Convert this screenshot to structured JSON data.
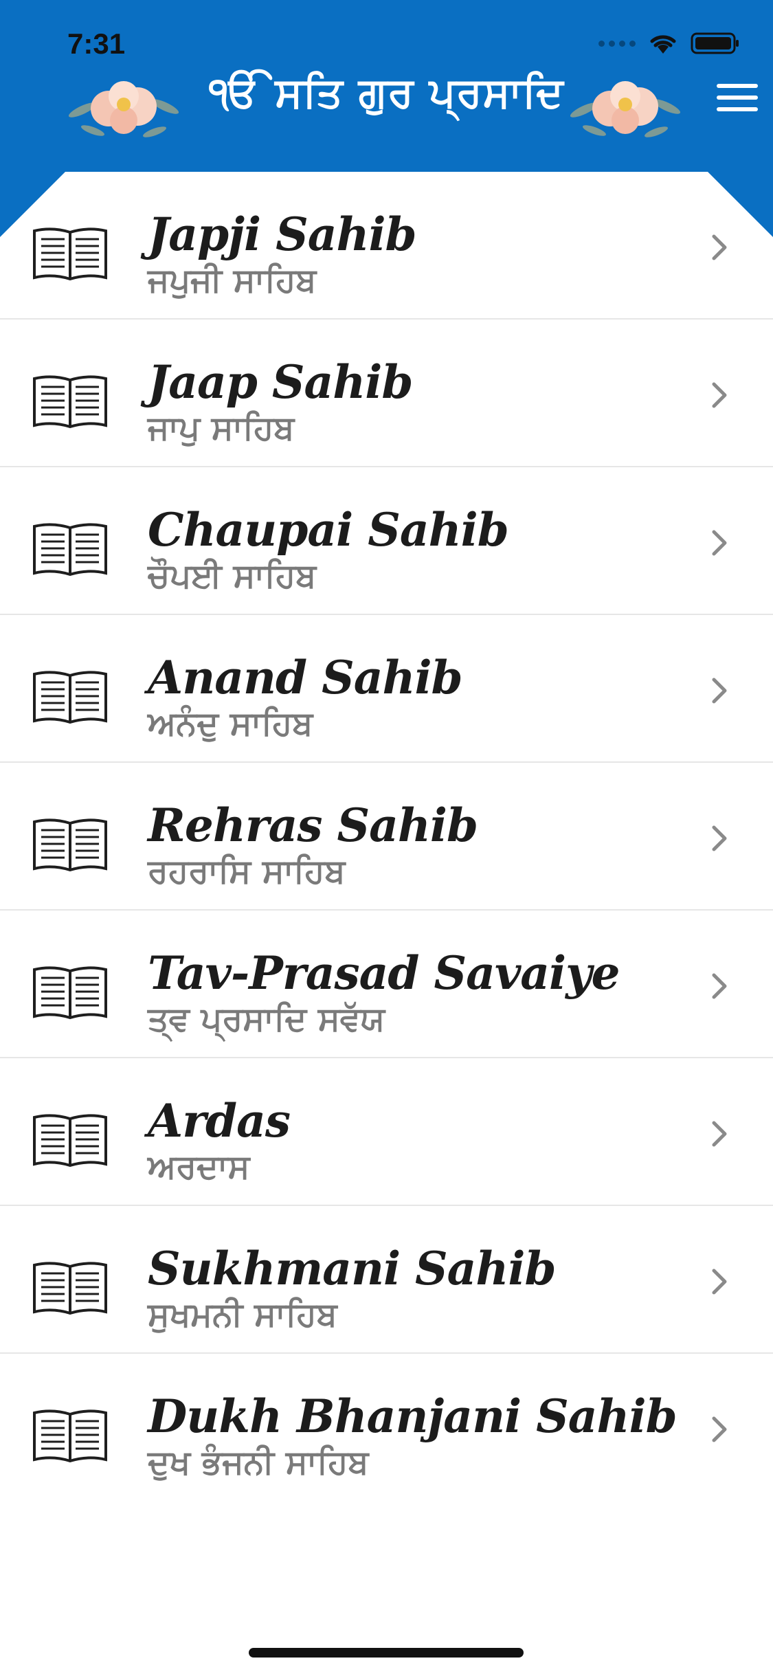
{
  "status_bar": {
    "time": "7:31"
  },
  "header": {
    "title": "ੴ ਸਤਿ ਗੁਰ ਪ੍ਰਸਾਦਿ",
    "accent": "#0a6fc2"
  },
  "items": [
    {
      "english": "Japji Sahib",
      "punjabi": "ਜਪੁਜੀ ਸਾਹਿਬ"
    },
    {
      "english": "Jaap Sahib",
      "punjabi": "ਜਾਪੁ ਸਾਹਿਬ"
    },
    {
      "english": "Chaupai Sahib",
      "punjabi": "ਚੌਪਈ ਸਾਹਿਬ"
    },
    {
      "english": "Anand Sahib",
      "punjabi": "ਅਨੰਦੁ ਸਾਹਿਬ"
    },
    {
      "english": "Rehras Sahib",
      "punjabi": "ਰਹਰਾਸਿ ਸਾਹਿਬ"
    },
    {
      "english": "Tav-Prasad Savaiye",
      "punjabi": "ਤ੍ਵ ਪ੍ਰਸਾਦਿ ਸਵੱਯ"
    },
    {
      "english": "Ardas",
      "punjabi": "ਅਰਦਾਸ"
    },
    {
      "english": "Sukhmani Sahib",
      "punjabi": "ਸੁਖਮਨੀ ਸਾਹਿਬ"
    },
    {
      "english": "Dukh Bhanjani Sahib",
      "punjabi": "ਦੁਖ ਭੰਜਨੀ ਸਾਹਿਬ"
    }
  ]
}
